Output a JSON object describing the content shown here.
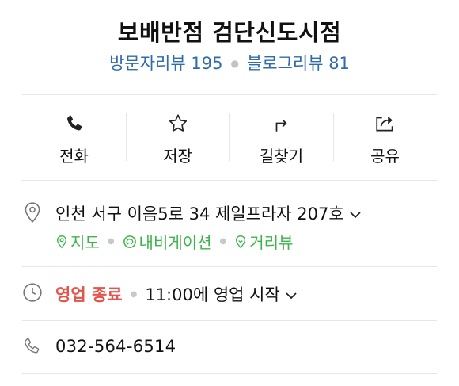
{
  "place": {
    "title": "보배반점 검단신도시점",
    "visitor_reviews_label": "방문자리뷰 195",
    "blog_reviews_label": "블로그리뷰 81"
  },
  "actions": [
    {
      "label": "전화",
      "icon": "phone-icon"
    },
    {
      "label": "저장",
      "icon": "star-icon"
    },
    {
      "label": "길찾기",
      "icon": "directions-icon"
    },
    {
      "label": "공유",
      "icon": "share-icon"
    }
  ],
  "address": {
    "text": "인천 서구 이음5로 34 제일프라자 207호",
    "links": [
      {
        "label": "지도",
        "icon": "map-pin-icon"
      },
      {
        "label": "내비게이션",
        "icon": "car-icon"
      },
      {
        "label": "거리뷰",
        "icon": "street-view-icon"
      }
    ]
  },
  "hours": {
    "status": "영업 종료",
    "next_open": "11:00에 영업 시작"
  },
  "phone": {
    "number": "032-564-6514"
  },
  "colors": {
    "review_link": "#2f6ca8",
    "green_link": "#3bb54a",
    "closed_status": "#e5534b",
    "divider": "#e6e6e6"
  }
}
